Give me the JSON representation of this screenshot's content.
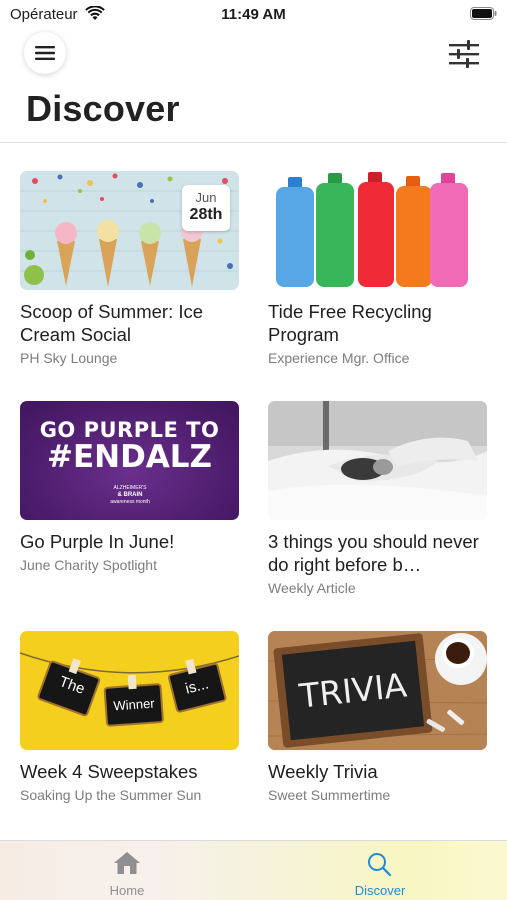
{
  "status": {
    "carrier": "Opérateur",
    "time": "11:49 AM"
  },
  "header": {
    "title": "Discover"
  },
  "cards": [
    {
      "title": "Scoop of Summer: Ice Cream Social",
      "subtitle": "PH Sky Lounge",
      "badge_month": "Jun",
      "badge_day": "28th"
    },
    {
      "title": "Tide Free Recycling Program",
      "subtitle": "Experience Mgr. Office"
    },
    {
      "title": "Go Purple In June!",
      "subtitle": "June Charity Spotlight",
      "image_line1": "GO PURPLE TO",
      "image_line2": "#ENDALZ",
      "image_logo_line1": "ALZHEIMER'S",
      "image_logo_line2": "& BRAIN",
      "image_logo_line3": "awareness month"
    },
    {
      "title": "3 things you should never do right before b…",
      "subtitle": "Weekly Article"
    },
    {
      "title": "Week 4 Sweepstakes",
      "subtitle": "Soaking Up the Summer Sun",
      "image_sign1": "The",
      "image_sign2": "Winner",
      "image_sign3": "is..."
    },
    {
      "title": "Weekly Trivia",
      "subtitle": "Sweet Summertime",
      "image_text": "TRIVIA"
    }
  ],
  "tabbar": {
    "home_label": "Home",
    "discover_label": "Discover",
    "active_color": "#1e8bd8",
    "inactive_color": "#8e8e93"
  }
}
